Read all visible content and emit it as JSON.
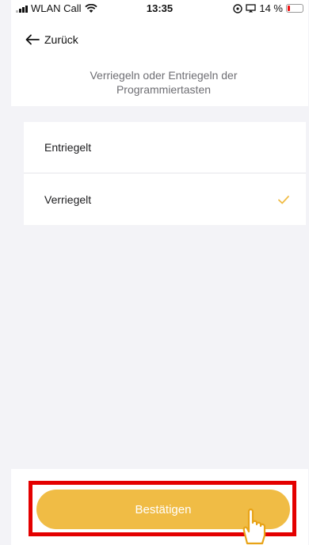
{
  "status_bar": {
    "carrier": "WLAN Call",
    "time": "13:35",
    "battery": "14 %"
  },
  "header": {
    "back_label": "Zurück",
    "subtitle": "Verriegeln oder Entriegeln der Programmiertasten"
  },
  "options": [
    {
      "label": "Entriegelt",
      "selected": false
    },
    {
      "label": "Verriegelt",
      "selected": true
    }
  ],
  "footer": {
    "confirm_label": "Bestätigen"
  },
  "colors": {
    "accent": "#f0bc45",
    "highlight": "#e40000"
  },
  "icons": [
    "back-arrow-icon",
    "check-icon",
    "tap-hand-icon",
    "wifi-icon",
    "battery-icon"
  ]
}
